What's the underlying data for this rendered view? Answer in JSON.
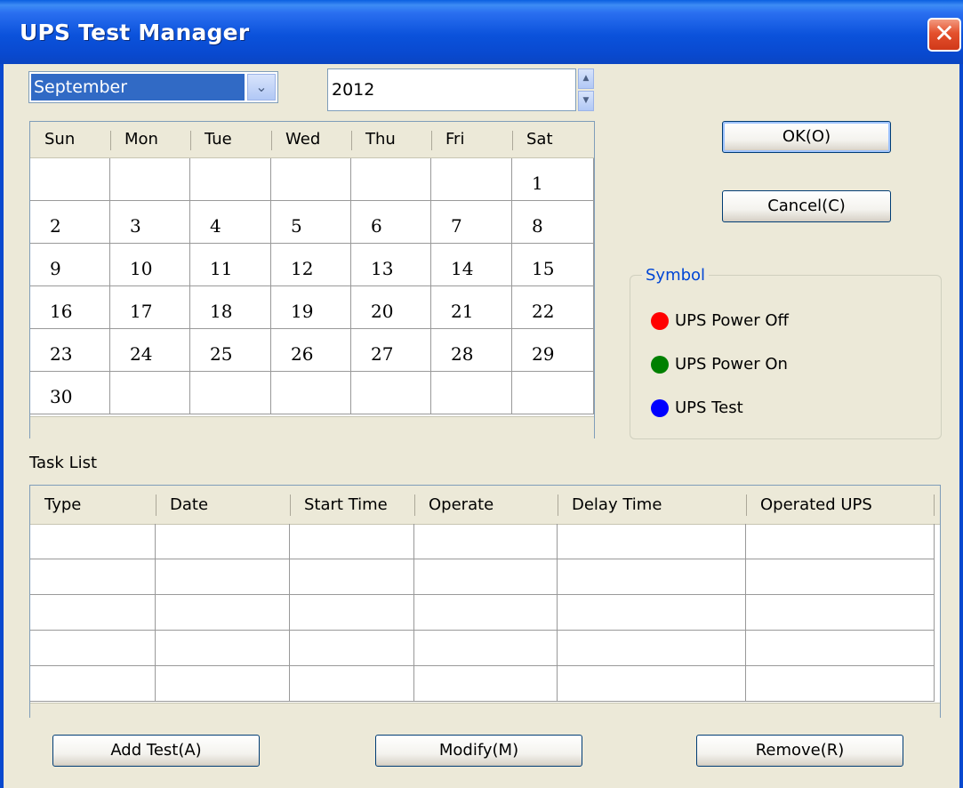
{
  "window": {
    "title": "UPS Test Manager",
    "close_glyph": "✕"
  },
  "month_selector": {
    "value": "September",
    "arrow": "⌄"
  },
  "year_field": {
    "value": "2012",
    "up": "▲",
    "down": "▼"
  },
  "calendar": {
    "weekdays": [
      "Sun",
      "Mon",
      "Tue",
      "Wed",
      "Thu",
      "Fri",
      "Sat"
    ],
    "weeks": [
      [
        "",
        "",
        "",
        "",
        "",
        "",
        "1"
      ],
      [
        "2",
        "3",
        "4",
        "5",
        "6",
        "7",
        "8"
      ],
      [
        "9",
        "10",
        "11",
        "12",
        "13",
        "14",
        "15"
      ],
      [
        "16",
        "17",
        "18",
        "19",
        "20",
        "21",
        "22"
      ],
      [
        "23",
        "24",
        "25",
        "26",
        "27",
        "28",
        "29"
      ],
      [
        "30",
        "",
        "",
        "",
        "",
        "",
        ""
      ]
    ]
  },
  "buttons": {
    "ok": "OK(O)",
    "cancel": "Cancel(C)",
    "add_test": "Add Test(A)",
    "modify": "Modify(M)",
    "remove": "Remove(R)"
  },
  "symbol": {
    "title": "Symbol",
    "items": [
      {
        "label": "UPS Power Off",
        "color": "#ff0000"
      },
      {
        "label": "UPS Power On",
        "color": "#008000"
      },
      {
        "label": "UPS Test",
        "color": "#0000ff"
      }
    ]
  },
  "task_list": {
    "label": "Task List",
    "columns": [
      "Type",
      "Date",
      "Start Time",
      "Operate",
      "Delay Time",
      "Operated UPS"
    ],
    "rows": [
      [
        "",
        "",
        "",
        "",
        "",
        ""
      ],
      [
        "",
        "",
        "",
        "",
        "",
        ""
      ],
      [
        "",
        "",
        "",
        "",
        "",
        ""
      ],
      [
        "",
        "",
        "",
        "",
        "",
        ""
      ],
      [
        "",
        "",
        "",
        "",
        "",
        ""
      ]
    ]
  }
}
